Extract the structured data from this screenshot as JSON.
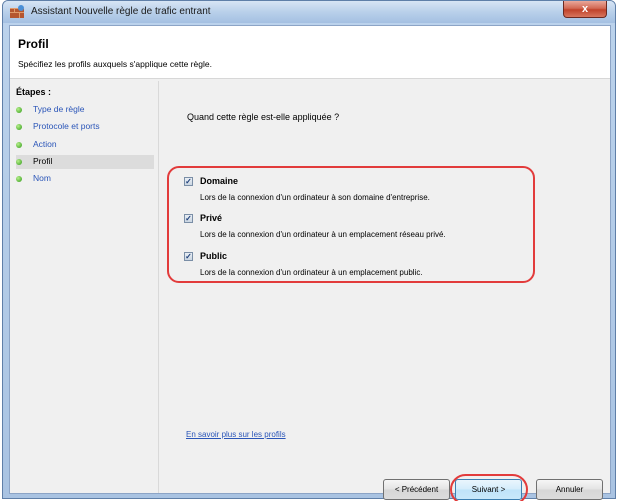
{
  "window": {
    "title": "Assistant Nouvelle règle de trafic entrant",
    "close_label": "x"
  },
  "header": {
    "title": "Profil",
    "subtitle": "Spécifiez les profils auxquels s'applique cette règle."
  },
  "steps": {
    "title": "Étapes :",
    "items": [
      {
        "label": "Type de règle",
        "active": false
      },
      {
        "label": "Protocole et ports",
        "active": false
      },
      {
        "label": "Action",
        "active": false
      },
      {
        "label": "Profil",
        "active": true
      },
      {
        "label": "Nom",
        "active": false
      }
    ]
  },
  "content": {
    "question": "Quand cette règle est-elle appliquée ?",
    "options": [
      {
        "label": "Domaine",
        "checked": true,
        "description": "Lors de la connexion d'un ordinateur à son domaine d'entreprise."
      },
      {
        "label": "Privé",
        "checked": true,
        "description": "Lors de la connexion d'un ordinateur à un emplacement réseau privé."
      },
      {
        "label": "Public",
        "checked": true,
        "description": "Lors de la connexion d'un ordinateur à un emplacement public."
      }
    ],
    "link": "En savoir plus sur les profils"
  },
  "buttons": {
    "previous": "< Précédent",
    "next": "Suivant >",
    "cancel": "Annuler"
  },
  "colors": {
    "link": "#2a55b8",
    "highlight": "#e23b3b",
    "step_dot": "#2f9a17"
  }
}
